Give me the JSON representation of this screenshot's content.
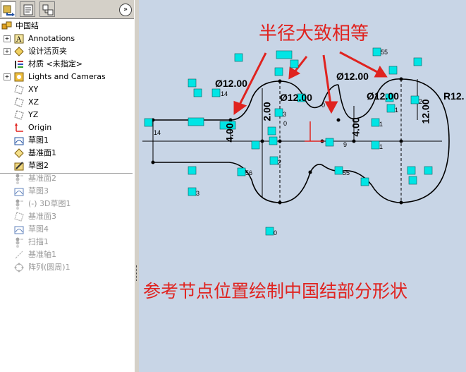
{
  "tree": {
    "root": "中国结",
    "items": [
      {
        "label": "Annotations",
        "icon": "annotations-icon",
        "expand": "+",
        "suppressed": false
      },
      {
        "label": "设计活页夹",
        "icon": "design-binder-icon",
        "expand": "+",
        "suppressed": false
      },
      {
        "label": "材质 <未指定>",
        "icon": "material-icon",
        "expand": "",
        "suppressed": false
      },
      {
        "label": "Lights and Cameras",
        "icon": "lights-cameras-icon",
        "expand": "+",
        "suppressed": false
      },
      {
        "label": "XY",
        "icon": "plane-icon",
        "expand": "",
        "suppressed": false
      },
      {
        "label": "XZ",
        "icon": "plane-icon",
        "expand": "",
        "suppressed": false
      },
      {
        "label": "YZ",
        "icon": "plane-icon",
        "expand": "",
        "suppressed": false
      },
      {
        "label": "Origin",
        "icon": "origin-icon",
        "expand": "",
        "suppressed": false
      },
      {
        "label": "草图1",
        "icon": "sketch-icon",
        "expand": "",
        "suppressed": false
      },
      {
        "label": "基准面1",
        "icon": "ref-plane-icon",
        "expand": "",
        "suppressed": false
      },
      {
        "label": "草图2",
        "icon": "sketch-edit-icon",
        "expand": "",
        "suppressed": false
      },
      {
        "label": "基准面2",
        "icon": "rollback-icon",
        "expand": "",
        "suppressed": true
      },
      {
        "label": "草图3",
        "icon": "sketch-icon",
        "expand": "",
        "suppressed": true
      },
      {
        "label": "(-) 3D草图1",
        "icon": "rollback-icon",
        "expand": "",
        "suppressed": true
      },
      {
        "label": "基准面3",
        "icon": "plane-icon",
        "expand": "",
        "suppressed": true
      },
      {
        "label": "草图4",
        "icon": "sketch-icon",
        "expand": "",
        "suppressed": true
      },
      {
        "label": "扫描1",
        "icon": "rollback-icon",
        "expand": "",
        "suppressed": true
      },
      {
        "label": "基准轴1",
        "icon": "axis-icon",
        "expand": "",
        "suppressed": true
      },
      {
        "label": "阵列(圆周)1",
        "icon": "pattern-icon",
        "expand": "",
        "suppressed": true
      }
    ]
  },
  "tabs": [
    {
      "name": "feature-manager-tab",
      "icon": "feature-manager-icon"
    },
    {
      "name": "property-manager-tab",
      "icon": "property-manager-icon"
    },
    {
      "name": "configuration-manager-tab",
      "icon": "configuration-manager-icon"
    }
  ],
  "collapse_glyph": "»",
  "annotations": {
    "top": "半径大致相等",
    "bottom": "参考节点位置绘制中国结部分形状"
  },
  "dimensions": [
    "Ø12.00",
    "Ø12.00",
    "Ø12.00",
    "Ø12.00",
    "R12.",
    "12.00",
    "4.00",
    "4.00",
    "2.00"
  ],
  "relation_tags": [
    "55",
    "14",
    "14",
    "56",
    "55",
    "3",
    "2",
    "0",
    "9",
    "1",
    "1",
    "2",
    "1",
    "3",
    "0",
    "0"
  ],
  "colors": {
    "annotation": "#e0231f",
    "viewport_bg": "#c8d5e6",
    "relation_tag_bg": "#00e5e5",
    "origin": "#e0231f"
  }
}
